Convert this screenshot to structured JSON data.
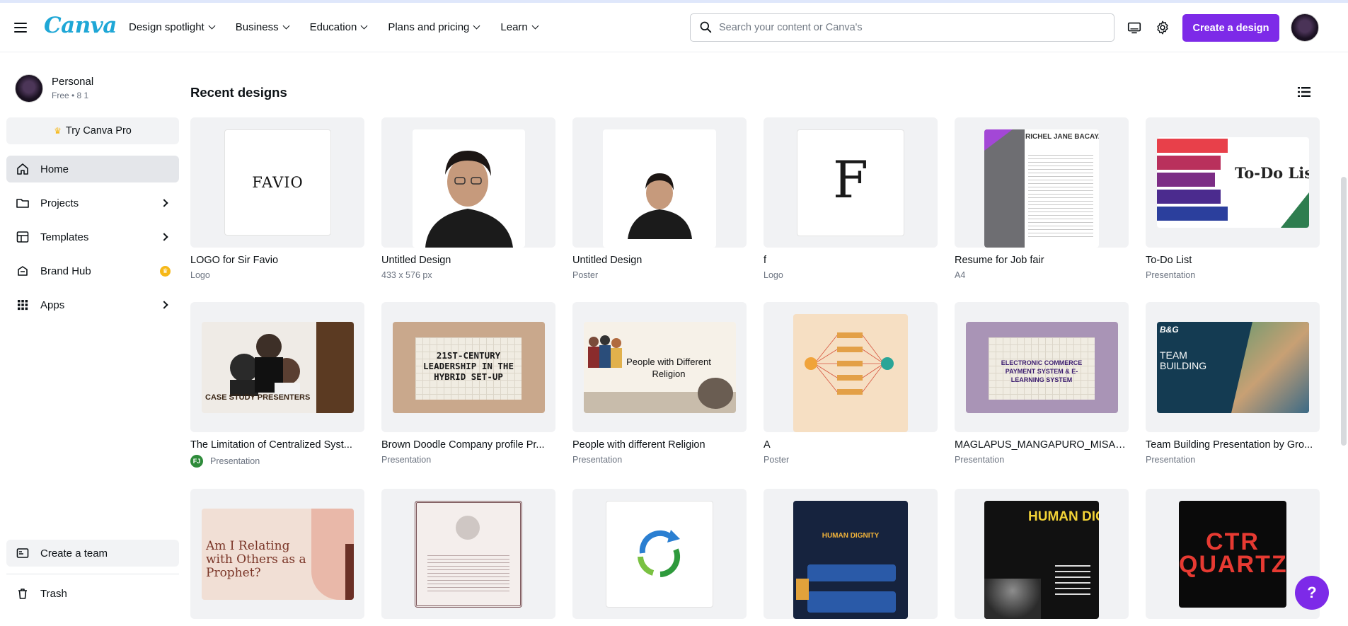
{
  "header": {
    "logo": "Canva",
    "nav": [
      "Design spotlight",
      "Business",
      "Education",
      "Plans and pricing",
      "Learn"
    ],
    "search_placeholder": "Search your content or Canva's",
    "create_button": "Create a design"
  },
  "sidebar": {
    "account_name": "Personal",
    "account_sub": "Free • 8 1",
    "try_pro": "Try Canva Pro",
    "items": [
      {
        "label": "Home"
      },
      {
        "label": "Projects"
      },
      {
        "label": "Templates"
      },
      {
        "label": "Brand Hub"
      },
      {
        "label": "Apps"
      }
    ],
    "create_team": "Create a team",
    "trash": "Trash"
  },
  "main": {
    "section_title": "Recent designs",
    "designs": [
      {
        "title": "LOGO for Sir Favio",
        "sub": "Logo",
        "thumb_text": "FAVIO"
      },
      {
        "title": "Untitled Design",
        "sub": "433 x 576 px"
      },
      {
        "title": "Untitled Design",
        "sub": "Poster"
      },
      {
        "title": "f",
        "sub": "Logo",
        "thumb_text": "F"
      },
      {
        "title": "Resume for Job fair",
        "sub": "A4",
        "thumb_text": "RICHEL JANE BACAYAN"
      },
      {
        "title": "To-Do List",
        "sub": "Presentation",
        "thumb_text": "To-Do List"
      },
      {
        "title": "The Limitation of Centralized Syst...",
        "sub": "Presentation",
        "owner_initials": "FJ",
        "thumb_text": "CASE STUDY PRESENTERS"
      },
      {
        "title": "Brown Doodle Company profile Pr...",
        "sub": "Presentation",
        "thumb_text": "21ST-CENTURY LEADERSHIP IN THE HYBRID SET-UP"
      },
      {
        "title": "People with different Religion",
        "sub": "Presentation",
        "thumb_text": "People with Different Religion"
      },
      {
        "title": "A",
        "sub": "Poster"
      },
      {
        "title": "MAGLAPUS_MANGAPURO_MISA_...",
        "sub": "Presentation",
        "thumb_text": "ELECTRONIC COMMERCE PAYMENT SYSTEM & E-LEARNING SYSTEM"
      },
      {
        "title": "Team Building Presentation by Gro...",
        "sub": "Presentation",
        "thumb_text": "TEAM BUILDING"
      },
      {
        "title": "",
        "sub": "",
        "thumb_text": "Am I Relating with Others as a Prophet?"
      },
      {
        "title": "",
        "sub": ""
      },
      {
        "title": "",
        "sub": ""
      },
      {
        "title": "",
        "sub": "",
        "thumb_text": "HUMAN DIGNITY"
      },
      {
        "title": "",
        "sub": "",
        "thumb_text": "HUMAN DIGNITY"
      },
      {
        "title": "",
        "sub": "",
        "thumb_text": "CTR QUARTZ"
      }
    ]
  },
  "help_label": "?",
  "colors": {
    "brand": "#7d2ae8",
    "logo": "#1fa7d6",
    "active": "#e4e6ea"
  }
}
